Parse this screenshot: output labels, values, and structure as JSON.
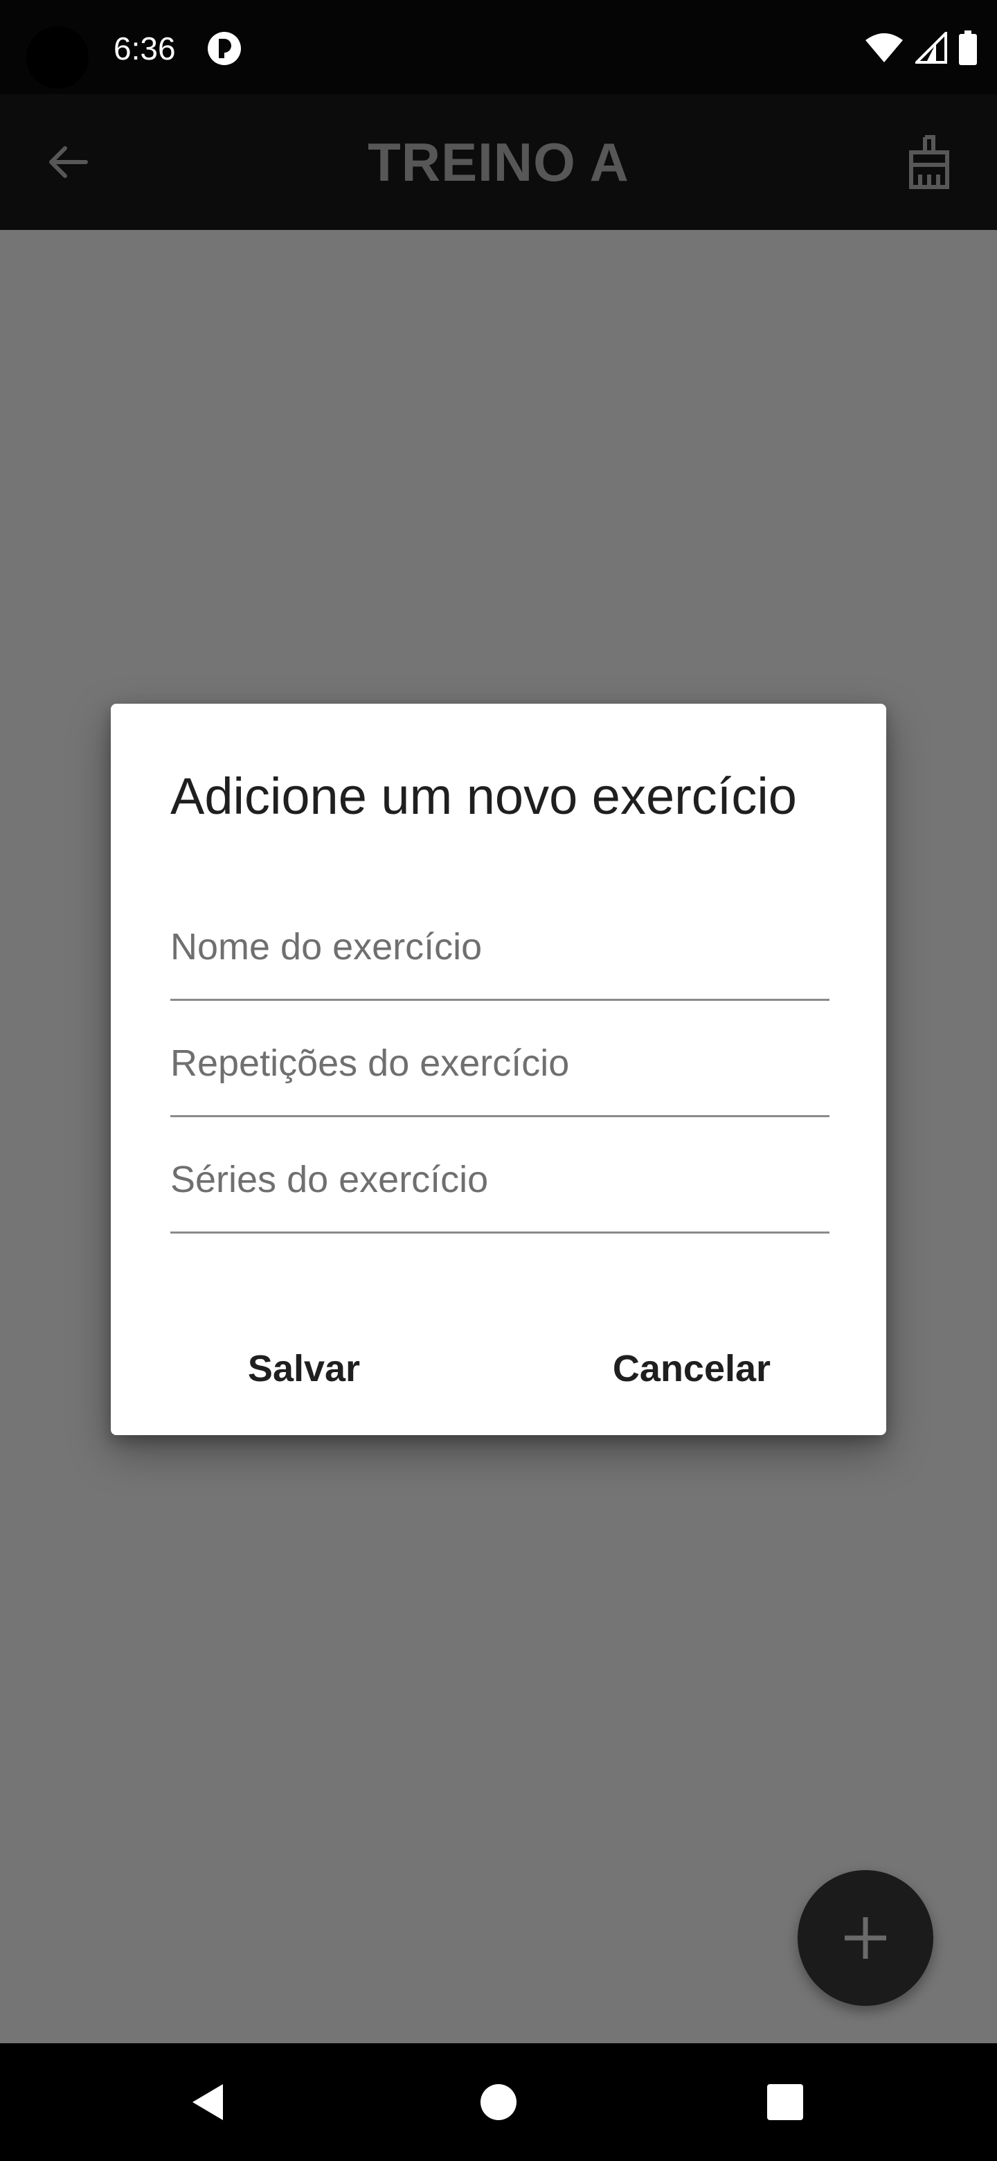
{
  "status_bar": {
    "time": "6:36",
    "icons": [
      "app-notification-icon",
      "wifi-icon",
      "signal-icon",
      "battery-icon"
    ]
  },
  "app_bar": {
    "title": "TREINO A",
    "back_icon": "arrow-left-icon",
    "action_icon": "broom-icon"
  },
  "dialog": {
    "title": "Adicione um novo exercício",
    "fields": [
      {
        "placeholder": "Nome do exercício",
        "value": ""
      },
      {
        "placeholder": "Repetições do exercício",
        "value": ""
      },
      {
        "placeholder": "Séries do exercício",
        "value": ""
      }
    ],
    "save_label": "Salvar",
    "cancel_label": "Cancelar"
  },
  "fab": {
    "icon": "plus-icon"
  },
  "nav_bar": {
    "icons": [
      "back-triangle-icon",
      "home-circle-icon",
      "recents-square-icon"
    ]
  },
  "colors": {
    "scrim": "#757575",
    "app_bar": "#0c0c0c",
    "dialog_bg": "#ffffff",
    "fab": "#1b1b1b"
  }
}
